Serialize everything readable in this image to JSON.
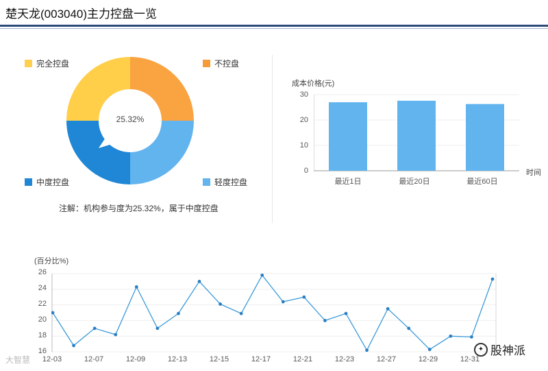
{
  "header": {
    "title": "楚天龙(003040)主力控盘一览"
  },
  "donut": {
    "center_label": "25.32%",
    "legend": [
      {
        "label": "完全控盘",
        "color": "#ffd04d"
      },
      {
        "label": "不控盘",
        "color": "#f59b3a"
      },
      {
        "label": "中度控盘",
        "color": "#1f87d6"
      },
      {
        "label": "轻度控盘",
        "color": "#62b4ef"
      }
    ],
    "segments": [
      {
        "name": "不控盘",
        "value": 25,
        "color": "#f9a341"
      },
      {
        "name": "轻度控盘",
        "value": 25,
        "color": "#62b4ef"
      },
      {
        "name": "中度控盘",
        "value": 25,
        "color": "#1f87d6"
      },
      {
        "name": "完全控盘",
        "value": 25,
        "color": "#ffcf4a"
      }
    ],
    "note": "注解：机构参与度为25.32%，属于中度控盘"
  },
  "chart_data": [
    {
      "type": "bar",
      "categories": [
        "最近1日",
        "最近20日",
        "最近60日"
      ],
      "values": [
        27,
        27.6,
        26.3
      ],
      "ylabel": "成本价格(元)",
      "xlabel": "时间",
      "ylim": [
        0,
        30
      ],
      "yticks": [
        "30",
        "20",
        "10",
        "0"
      ],
      "color": "#62b4ef"
    },
    {
      "type": "line",
      "ylabel": "(百分比%)",
      "ylim": [
        16,
        26
      ],
      "yticks": [
        "26",
        "24",
        "22",
        "20",
        "18",
        "16"
      ],
      "x_tick_labels": [
        "12-03",
        "12-07",
        "12-09",
        "12-13",
        "12-15",
        "12-17",
        "12-21",
        "12-23",
        "12-27",
        "12-29",
        "12-31"
      ],
      "values": [
        21.0,
        16.8,
        19.0,
        18.2,
        24.3,
        19.0,
        20.9,
        25.0,
        22.1,
        20.9,
        25.8,
        22.4,
        23.0,
        20.0,
        20.9,
        16.2,
        21.5,
        19.0,
        16.3,
        18.0,
        17.9,
        25.3
      ],
      "color": "#3a9ad9"
    }
  ],
  "watermarks": {
    "left": "大智慧",
    "brand": "股神派"
  }
}
